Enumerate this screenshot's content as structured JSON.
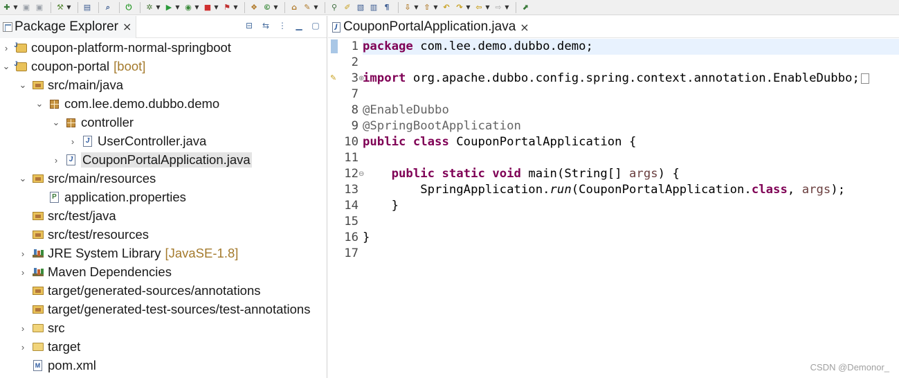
{
  "toolbar": {
    "items": [
      {
        "name": "new-icon",
        "glyph": "✚",
        "color": "#3a7a3a",
        "arrow": true
      },
      {
        "name": "save-icon",
        "glyph": "▣",
        "color": "#9aa0a8",
        "arrow": false
      },
      {
        "name": "save-all-icon",
        "glyph": "▣",
        "color": "#9aa0a8",
        "arrow": false
      },
      {
        "sep": true
      },
      {
        "name": "build-icon",
        "glyph": "⚒",
        "color": "#5a8a3a",
        "arrow": true
      },
      {
        "sep": true
      },
      {
        "name": "terminal-icon",
        "glyph": "▤",
        "color": "#3a5a90",
        "arrow": false
      },
      {
        "sep": true
      },
      {
        "name": "search-icon",
        "glyph": "⌕",
        "color": "#3a5a90",
        "arrow": false
      },
      {
        "sep": true
      },
      {
        "name": "power-icon",
        "glyph": "⏻",
        "color": "#2a9a2a",
        "arrow": false
      },
      {
        "sep": true
      },
      {
        "name": "debug-icon",
        "glyph": "✲",
        "color": "#4a7a3a",
        "arrow": true
      },
      {
        "name": "run-icon",
        "glyph": "▶",
        "color": "#2a9a3a",
        "arrow": true
      },
      {
        "name": "coverage-icon",
        "glyph": "◉",
        "color": "#3a8a3a",
        "arrow": true
      },
      {
        "name": "stop-icon",
        "glyph": "■",
        "color": "#d03030",
        "arrow": true
      },
      {
        "name": "external-tools-icon",
        "glyph": "⚑",
        "color": "#c03030",
        "arrow": true
      },
      {
        "sep": true
      },
      {
        "name": "new-java-package-icon",
        "glyph": "❖",
        "color": "#b07a2a",
        "arrow": false
      },
      {
        "name": "new-java-class-icon",
        "glyph": "©",
        "color": "#3a8a3a",
        "arrow": true
      },
      {
        "sep": true
      },
      {
        "name": "open-type-icon",
        "glyph": "⌂",
        "color": "#b07a2a",
        "arrow": false
      },
      {
        "name": "open-task-icon",
        "glyph": "✎",
        "color": "#b07a2a",
        "arrow": true
      },
      {
        "sep": true
      },
      {
        "name": "toggle-breadcrumb-icon",
        "glyph": "⚲",
        "color": "#3a6a3a",
        "arrow": false
      },
      {
        "name": "mark-occurrences-icon",
        "glyph": "✐",
        "color": "#c8a020",
        "arrow": false
      },
      {
        "name": "block-selection-icon",
        "glyph": "▧",
        "color": "#3a5a90",
        "arrow": false
      },
      {
        "name": "word-wrap-icon",
        "glyph": "▥",
        "color": "#3a5a90",
        "arrow": false
      },
      {
        "name": "show-whitespace-icon",
        "glyph": "¶",
        "color": "#3a5a90",
        "arrow": false
      },
      {
        "sep": true
      },
      {
        "name": "next-annotation-icon",
        "glyph": "⇩",
        "color": "#b07a2a",
        "arrow": true
      },
      {
        "name": "previous-annotation-icon",
        "glyph": "⇧",
        "color": "#b07a2a",
        "arrow": true
      },
      {
        "name": "last-edit-location-icon",
        "glyph": "↶",
        "color": "#c8a020",
        "arrow": false
      },
      {
        "name": "forward-edit-icon",
        "glyph": "↷",
        "color": "#c8a020",
        "arrow": true
      },
      {
        "name": "back-icon",
        "glyph": "⇦",
        "color": "#c8a020",
        "arrow": true
      },
      {
        "name": "forward-icon",
        "glyph": "⇨",
        "color": "#b8b8b8",
        "arrow": true
      },
      {
        "sep": true
      },
      {
        "name": "pin-editor-icon",
        "glyph": "⬈",
        "color": "#3a7a3a",
        "arrow": false
      }
    ]
  },
  "explorer": {
    "title": "Package Explorer",
    "close": "×",
    "actions": [
      {
        "name": "collapse-all-icon",
        "glyph": "⊟"
      },
      {
        "name": "link-with-editor-icon",
        "glyph": "⇆"
      },
      {
        "name": "view-menu-icon",
        "glyph": "⋮"
      },
      {
        "name": "minimize-icon",
        "glyph": "▁"
      },
      {
        "name": "maximize-icon",
        "glyph": "▢"
      }
    ],
    "tree": [
      {
        "label": "coupon-platform-normal-springboot",
        "deco": "",
        "twisty": "›",
        "icon": "i-proj",
        "depth": 0,
        "selected": false
      },
      {
        "label": "coupon-portal",
        "deco": "[boot]",
        "twisty": "⌄",
        "icon": "i-proj",
        "depth": 0,
        "selected": false
      },
      {
        "label": "src/main/java",
        "deco": "",
        "twisty": "⌄",
        "icon": "i-srcf",
        "depth": 1,
        "selected": false
      },
      {
        "label": "com.lee.demo.dubbo.demo",
        "deco": "",
        "twisty": "⌄",
        "icon": "i-pkg",
        "depth": 2,
        "selected": false
      },
      {
        "label": "controller",
        "deco": "",
        "twisty": "⌄",
        "icon": "i-pkg",
        "depth": 3,
        "selected": false
      },
      {
        "label": "UserController.java",
        "deco": "",
        "twisty": "›",
        "icon": "i-java",
        "depth": 4,
        "selected": false
      },
      {
        "label": "CouponPortalApplication.java",
        "deco": "",
        "twisty": "›",
        "icon": "i-java",
        "depth": 3,
        "selected": true
      },
      {
        "label": "src/main/resources",
        "deco": "",
        "twisty": "⌄",
        "icon": "i-srcf",
        "depth": 1,
        "selected": false
      },
      {
        "label": "application.properties",
        "deco": "",
        "twisty": "",
        "icon": "i-prop",
        "depth": 2,
        "selected": false
      },
      {
        "label": "src/test/java",
        "deco": "",
        "twisty": "",
        "icon": "i-srcf",
        "depth": 1,
        "selected": false
      },
      {
        "label": "src/test/resources",
        "deco": "",
        "twisty": "",
        "icon": "i-srcf",
        "depth": 1,
        "selected": false
      },
      {
        "label": "JRE System Library",
        "deco": "[JavaSE-1.8]",
        "twisty": "›",
        "icon": "i-lib",
        "depth": 1,
        "selected": false
      },
      {
        "label": "Maven Dependencies",
        "deco": "",
        "twisty": "›",
        "icon": "i-lib",
        "depth": 1,
        "selected": false
      },
      {
        "label": "target/generated-sources/annotations",
        "deco": "",
        "twisty": "",
        "icon": "i-srcf",
        "depth": 1,
        "selected": false
      },
      {
        "label": "target/generated-test-sources/test-annotations",
        "deco": "",
        "twisty": "",
        "icon": "i-srcf",
        "depth": 1,
        "selected": false
      },
      {
        "label": "src",
        "deco": "",
        "twisty": "›",
        "icon": "i-fold",
        "depth": 1,
        "selected": false
      },
      {
        "label": "target",
        "deco": "",
        "twisty": "›",
        "icon": "i-fold",
        "depth": 1,
        "selected": false
      },
      {
        "label": "pom.xml",
        "deco": "",
        "twisty": "",
        "icon": "i-xml",
        "depth": 1,
        "selected": false
      }
    ]
  },
  "editor": {
    "tab": {
      "title": "CouponPortalApplication.java",
      "close": "×"
    },
    "lines": [
      {
        "num": "1",
        "current": true,
        "fold": "",
        "tokens": [
          {
            "t": "package",
            "c": "kw"
          },
          {
            "t": " com.lee.demo.dubbo.demo;",
            "c": ""
          }
        ]
      },
      {
        "num": "2",
        "current": false,
        "fold": "",
        "tokens": []
      },
      {
        "num": "3",
        "current": false,
        "fold": "⊕",
        "tokens": [
          {
            "t": "import",
            "c": "kw"
          },
          {
            "t": " org.apache.dubbo.config.spring.context.annotation.EnableDubbo;",
            "c": ""
          }
        ],
        "collapsed": true
      },
      {
        "num": "7",
        "current": false,
        "fold": "",
        "tokens": []
      },
      {
        "num": "8",
        "current": false,
        "fold": "",
        "tokens": [
          {
            "t": "@EnableDubbo",
            "c": "ann"
          }
        ]
      },
      {
        "num": "9",
        "current": false,
        "fold": "",
        "tokens": [
          {
            "t": "@SpringBootApplication",
            "c": "ann"
          }
        ]
      },
      {
        "num": "10",
        "current": false,
        "fold": "",
        "tokens": [
          {
            "t": "public",
            "c": "kw"
          },
          {
            "t": " ",
            "c": ""
          },
          {
            "t": "class",
            "c": "kw"
          },
          {
            "t": " CouponPortalApplication {",
            "c": ""
          }
        ]
      },
      {
        "num": "11",
        "current": false,
        "fold": "",
        "tokens": []
      },
      {
        "num": "12",
        "current": false,
        "fold": "⊖",
        "tokens": [
          {
            "t": "    ",
            "c": ""
          },
          {
            "t": "public",
            "c": "kw"
          },
          {
            "t": " ",
            "c": ""
          },
          {
            "t": "static",
            "c": "kw"
          },
          {
            "t": " ",
            "c": ""
          },
          {
            "t": "void",
            "c": "kw"
          },
          {
            "t": " main(String[] ",
            "c": ""
          },
          {
            "t": "args",
            "c": "param"
          },
          {
            "t": ") {",
            "c": ""
          }
        ]
      },
      {
        "num": "13",
        "current": false,
        "fold": "",
        "tokens": [
          {
            "t": "        SpringApplication.",
            "c": ""
          },
          {
            "t": "run",
            "c": "italic"
          },
          {
            "t": "(CouponPortalApplication.",
            "c": ""
          },
          {
            "t": "class",
            "c": "kw"
          },
          {
            "t": ", ",
            "c": ""
          },
          {
            "t": "args",
            "c": "param"
          },
          {
            "t": ");",
            "c": ""
          }
        ]
      },
      {
        "num": "14",
        "current": false,
        "fold": "",
        "tokens": [
          {
            "t": "    }",
            "c": ""
          }
        ]
      },
      {
        "num": "15",
        "current": false,
        "fold": "",
        "tokens": []
      },
      {
        "num": "16",
        "current": false,
        "fold": "",
        "tokens": [
          {
            "t": "}",
            "c": ""
          }
        ]
      },
      {
        "num": "17",
        "current": false,
        "fold": "",
        "tokens": []
      }
    ]
  },
  "watermark": "CSDN @Demonor_"
}
